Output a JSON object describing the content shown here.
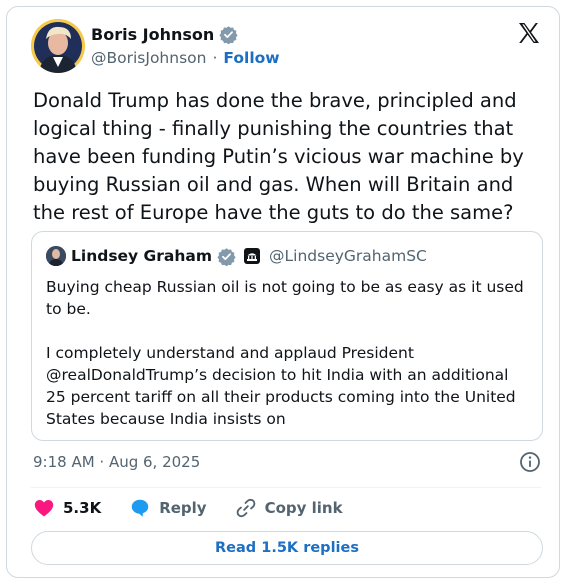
{
  "author": {
    "name": "Boris Johnson",
    "handle": "@BorisJohnson",
    "separator": "·",
    "follow_label": "Follow"
  },
  "tweet": {
    "text": "Donald Trump has done the brave, principled and logical thing - finally punishing the countries that have been funding Putin’s vicious war machine by buying Russian oil and gas. When will Britain and the rest of Europe have the guts to do the same?"
  },
  "quote": {
    "name": "Lindsey Graham",
    "handle": "@LindseyGrahamSC",
    "paragraph1": "Buying cheap Russian oil is not going to be as easy as it used to be.",
    "paragraph2": "I completely understand and applaud President @realDonaldTrump’s decision to hit India with an additional 25 percent tariff on all their products coming into the United States because India insists on"
  },
  "meta": {
    "timestamp": "9:18 AM · Aug 6, 2025"
  },
  "actions": {
    "likes": "5.3K",
    "reply_label": "Reply",
    "copy_link_label": "Copy link"
  },
  "footer": {
    "read_replies_label": "Read 1.5K replies"
  },
  "colors": {
    "link_blue": "#1d6fc2",
    "verified_gray": "#829aab",
    "like_pink": "#f91880",
    "reply_blue": "#1d9bf0",
    "muted_text": "#536471"
  },
  "icons": [
    "verified-icon",
    "x-logo-icon",
    "info-icon",
    "heart-icon",
    "reply-bubble-icon",
    "link-icon",
    "capitol-badge-icon"
  ]
}
